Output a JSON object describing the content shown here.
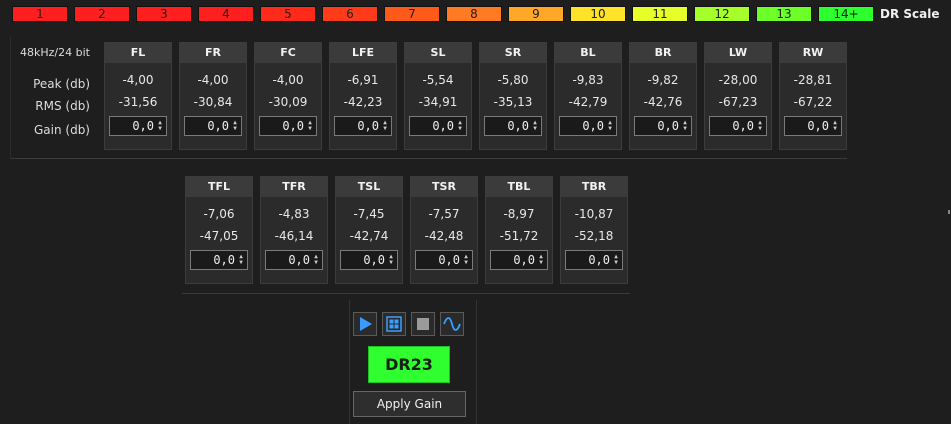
{
  "dr_scale": {
    "label": "DR Scale",
    "cells": [
      {
        "label": "1",
        "color": "#ff1f1f"
      },
      {
        "label": "2",
        "color": "#ff1f1f"
      },
      {
        "label": "3",
        "color": "#ff1f1f"
      },
      {
        "label": "4",
        "color": "#ff1f1f"
      },
      {
        "label": "5",
        "color": "#ff2a1a"
      },
      {
        "label": "6",
        "color": "#ff3b1a"
      },
      {
        "label": "7",
        "color": "#ff5a1a"
      },
      {
        "label": "8",
        "color": "#ff7a22"
      },
      {
        "label": "9",
        "color": "#ffa828"
      },
      {
        "label": "10",
        "color": "#ffe22a"
      },
      {
        "label": "11",
        "color": "#e6ff2a"
      },
      {
        "label": "12",
        "color": "#a6ff2a"
      },
      {
        "label": "13",
        "color": "#6cff2a"
      },
      {
        "label": "14+",
        "color": "#2eff2e"
      }
    ]
  },
  "format_label": "48kHz/24 bit",
  "row_labels": {
    "peak": "Peak (db)",
    "rms": "RMS (db)",
    "gain": "Gain (db)"
  },
  "channels_top": [
    {
      "name": "FL",
      "peak": "-4,00",
      "rms": "-31,56",
      "gain": "0,0"
    },
    {
      "name": "FR",
      "peak": "-4,00",
      "rms": "-30,84",
      "gain": "0,0"
    },
    {
      "name": "FC",
      "peak": "-4,00",
      "rms": "-30,09",
      "gain": "0,0"
    },
    {
      "name": "LFE",
      "peak": "-6,91",
      "rms": "-42,23",
      "gain": "0,0"
    },
    {
      "name": "SL",
      "peak": "-5,54",
      "rms": "-34,91",
      "gain": "0,0"
    },
    {
      "name": "SR",
      "peak": "-5,80",
      "rms": "-35,13",
      "gain": "0,0"
    },
    {
      "name": "BL",
      "peak": "-9,83",
      "rms": "-42,79",
      "gain": "0,0"
    },
    {
      "name": "BR",
      "peak": "-9,82",
      "rms": "-42,76",
      "gain": "0,0"
    },
    {
      "name": "LW",
      "peak": "-28,00",
      "rms": "-67,23",
      "gain": "0,0"
    },
    {
      "name": "RW",
      "peak": "-28,81",
      "rms": "-67,22",
      "gain": "0,0"
    }
  ],
  "channels_bottom": [
    {
      "name": "TFL",
      "peak": "-7,06",
      "rms": "-47,05",
      "gain": "0,0"
    },
    {
      "name": "TFR",
      "peak": "-4,83",
      "rms": "-46,14",
      "gain": "0,0"
    },
    {
      "name": "TSL",
      "peak": "-7,45",
      "rms": "-42,74",
      "gain": "0,0"
    },
    {
      "name": "TSR",
      "peak": "-7,57",
      "rms": "-42,48",
      "gain": "0,0"
    },
    {
      "name": "TBL",
      "peak": "-8,97",
      "rms": "-51,72",
      "gain": "0,0"
    },
    {
      "name": "TBR",
      "peak": "-10,87",
      "rms": "-52,18",
      "gain": "0,0"
    }
  ],
  "toolbar": [
    {
      "name": "play-icon"
    },
    {
      "name": "grid-icon"
    },
    {
      "name": "stop-icon"
    },
    {
      "name": "waveform-icon"
    }
  ],
  "dr_result": {
    "value": "DR23",
    "color": "#2fff2f"
  },
  "apply_button": "Apply Gain"
}
